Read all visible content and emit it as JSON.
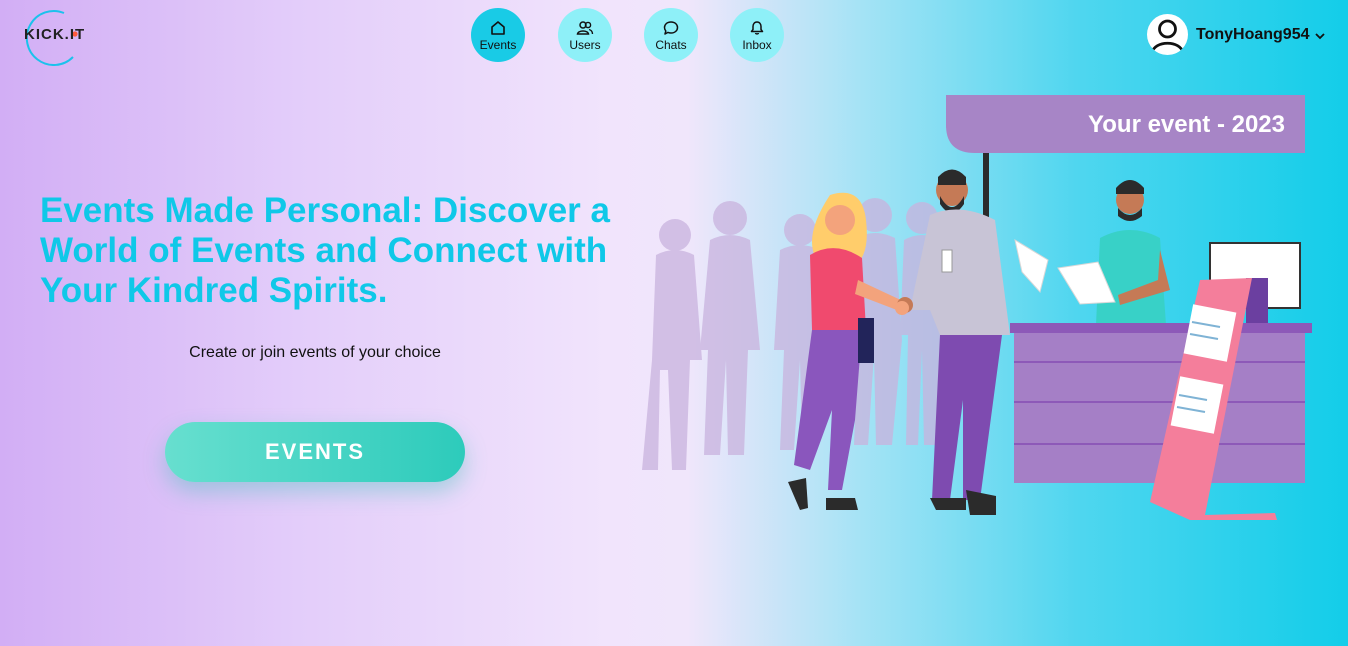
{
  "brand": {
    "logo_text": "KICK.IT"
  },
  "nav": {
    "items": [
      {
        "label": "Events",
        "icon": "home-icon",
        "active": true
      },
      {
        "label": "Users",
        "icon": "users-icon",
        "active": false
      },
      {
        "label": "Chats",
        "icon": "chat-icon",
        "active": false
      },
      {
        "label": "Inbox",
        "icon": "bell-icon",
        "active": false
      }
    ]
  },
  "user": {
    "name": "TonyHoang954",
    "avatar_icon": "user-avatar-icon",
    "menu_icon": "chevron-down-icon"
  },
  "hero": {
    "headline": "Events Made Personal: Discover a World of Events and Connect with Your Kindred Spirits.",
    "subtitle": "Create or join events of your choice",
    "cta_label": "EVENTS"
  },
  "illustration": {
    "banner_text": "Your event - 2023"
  },
  "colors": {
    "accent": "#0fc8e8",
    "cta": "#2dcbbb",
    "nav_bubble": "#8ef0f8",
    "nav_active": "#19cbe6"
  }
}
